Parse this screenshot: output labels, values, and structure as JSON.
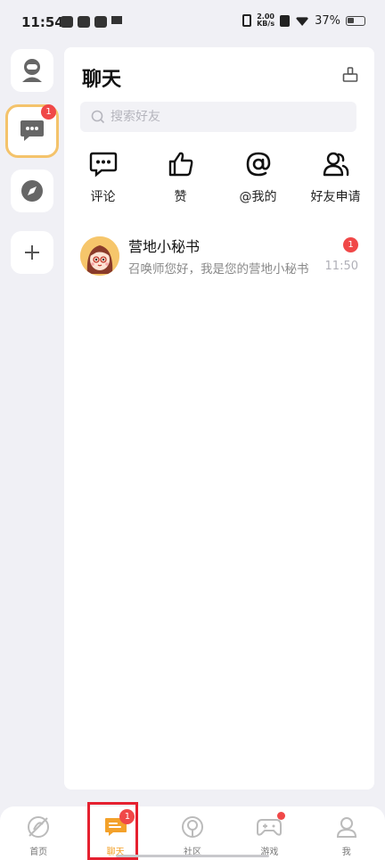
{
  "status_bar": {
    "time": "11:54",
    "net_speed_value": "2.00",
    "net_speed_unit": "KB/s",
    "battery": "37%"
  },
  "side_rail": {
    "chat_badge": "1"
  },
  "panel": {
    "title": "聊天",
    "search_placeholder": "搜索好友",
    "quick_actions": [
      {
        "label": "评论",
        "icon": "comment-icon"
      },
      {
        "label": "赞",
        "icon": "thumbs-up-icon"
      },
      {
        "label": "@我的",
        "icon": "at-icon"
      },
      {
        "label": "好友申请",
        "icon": "friend-request-icon"
      }
    ],
    "conversations": [
      {
        "name": "营地小秘书",
        "message": "召唤师您好，我是您的营地小秘书",
        "time": "11:50",
        "unread": "1"
      }
    ]
  },
  "bottom_nav": {
    "items": [
      {
        "label": "首页",
        "icon": "home-icon"
      },
      {
        "label": "聊天",
        "icon": "chat-icon",
        "badge": "1",
        "active": true
      },
      {
        "label": "社区",
        "icon": "community-icon"
      },
      {
        "label": "游戏",
        "icon": "game-icon",
        "dot": true
      },
      {
        "label": "我",
        "icon": "profile-icon"
      }
    ]
  },
  "colors": {
    "accent": "#f3a12a",
    "badge": "#f04848",
    "highlight": "#e5202f"
  }
}
